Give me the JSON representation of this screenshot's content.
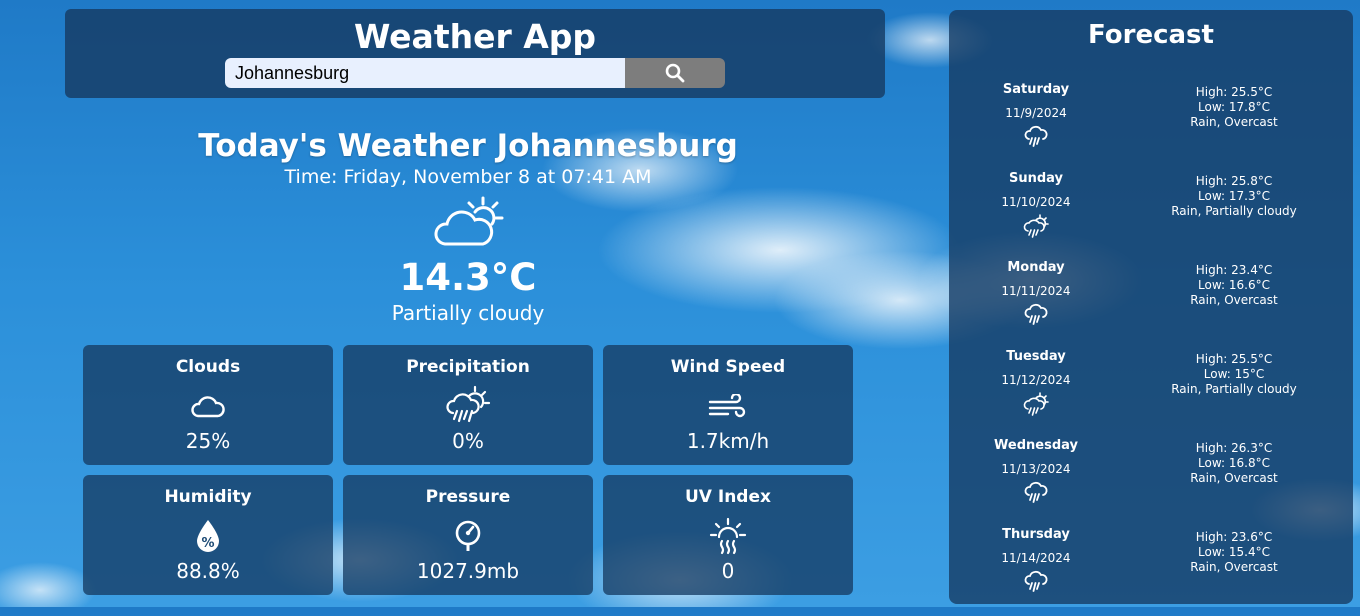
{
  "header": {
    "title": "Weather App",
    "search_value": "Johannesburg",
    "search_icon": "search-icon"
  },
  "today": {
    "title": "Today's Weather Johannesburg",
    "time": "Time: Friday, November 8 at 07:41 AM",
    "icon": "partly-cloudy-day-icon",
    "temp": "14.3°C",
    "condition": "Partially cloudy"
  },
  "stats": [
    {
      "label": "Clouds",
      "value": "25%",
      "icon": "cloud-icon"
    },
    {
      "label": "Precipitation",
      "value": "0%",
      "icon": "rain-sun-icon"
    },
    {
      "label": "Wind Speed",
      "value": "1.7km/h",
      "icon": "wind-icon"
    },
    {
      "label": "Humidity",
      "value": "88.8%",
      "icon": "humidity-drop-icon"
    },
    {
      "label": "Pressure",
      "value": "1027.9mb",
      "icon": "pressure-gauge-icon"
    },
    {
      "label": "UV Index",
      "value": "0",
      "icon": "uv-sun-icon"
    }
  ],
  "forecast": {
    "title": "Forecast",
    "days": [
      {
        "day": "Saturday",
        "date": "11/9/2024",
        "high": "High: 25.5°C",
        "low": "Low: 17.8°C",
        "cond": "Rain, Overcast",
        "icon": "rain-cloud-icon"
      },
      {
        "day": "Sunday",
        "date": "11/10/2024",
        "high": "High: 25.8°C",
        "low": "Low: 17.3°C",
        "cond": "Rain, Partially cloudy",
        "icon": "rain-partly-cloudy-icon"
      },
      {
        "day": "Monday",
        "date": "11/11/2024",
        "high": "High: 23.4°C",
        "low": "Low: 16.6°C",
        "cond": "Rain, Overcast",
        "icon": "rain-cloud-icon"
      },
      {
        "day": "Tuesday",
        "date": "11/12/2024",
        "high": "High: 25.5°C",
        "low": "Low: 15°C",
        "cond": "Rain, Partially cloudy",
        "icon": "rain-partly-cloudy-icon"
      },
      {
        "day": "Wednesday",
        "date": "11/13/2024",
        "high": "High: 26.3°C",
        "low": "Low: 16.8°C",
        "cond": "Rain, Overcast",
        "icon": "rain-cloud-icon"
      },
      {
        "day": "Thursday",
        "date": "11/14/2024",
        "high": "High: 23.6°C",
        "low": "Low: 15.4°C",
        "cond": "Rain, Overcast",
        "icon": "rain-cloud-icon"
      }
    ]
  }
}
